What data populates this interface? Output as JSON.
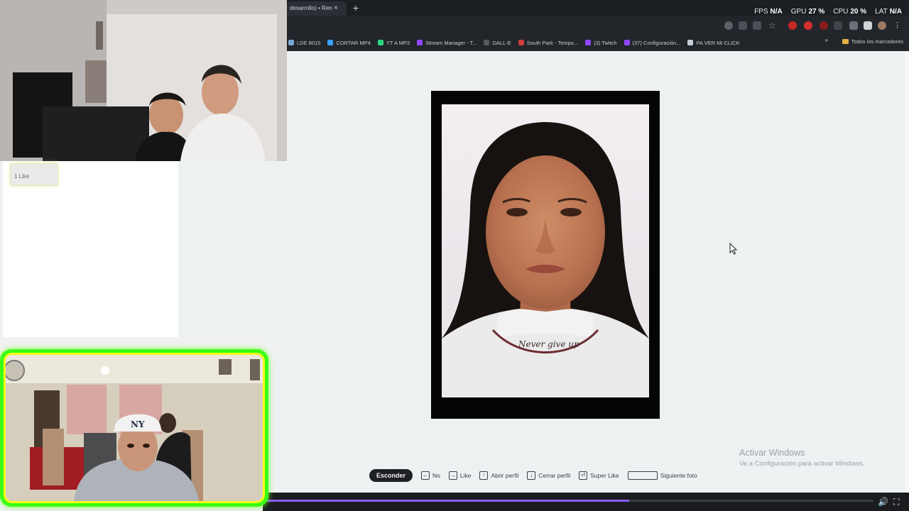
{
  "browser": {
    "tab": {
      "title": "desarrollo) • Ren",
      "close": "×"
    },
    "new_tab": "+",
    "perf": [
      {
        "label": "FPS",
        "value": "N/A"
      },
      {
        "label": "GPU",
        "value": "27 %"
      },
      {
        "label": "CPU",
        "value": "20 %"
      },
      {
        "label": "LAT",
        "value": "N/A"
      }
    ],
    "bookmarks": [
      {
        "label": "LDE 8015",
        "color": "#7aa7d8"
      },
      {
        "label": "CORTAR MP4",
        "color": "#3aa0ff"
      },
      {
        "label": "YT A MP3",
        "color": "#2bd47d"
      },
      {
        "label": "Stream Manager - T...",
        "color": "#9146ff"
      },
      {
        "label": "DALL-E",
        "color": "#555a60"
      },
      {
        "label": "South Park - Tempo...",
        "color": "#d23c3c"
      },
      {
        "label": "(3) Twitch",
        "color": "#9146ff"
      },
      {
        "label": "(37) Configuración...",
        "color": "#9146ff"
      },
      {
        "label": "PA VER MI CLICK",
        "color": "#c7d0da"
      }
    ],
    "bookmarks_more": "»",
    "all_bookmarks": "Todos los marcadores"
  },
  "overlay": {
    "like_badge": "1 Like"
  },
  "windows_watermark": {
    "title": "Activar Windows",
    "subtitle": "Ve a Configuración para activar Windows."
  },
  "controls": {
    "hide_label": "Esconder",
    "items": [
      {
        "key": "←",
        "label": "No"
      },
      {
        "key": "→",
        "label": "Like"
      },
      {
        "key": "↑",
        "label": "Abrir perfil"
      },
      {
        "key": "↓",
        "label": "Cerrar perfil"
      },
      {
        "key": "⏎",
        "label": "Super Like"
      }
    ],
    "next_photo": "Siguiente foto"
  },
  "media_progress": 0.6,
  "photo": {
    "shirt_text": "Never give up"
  }
}
